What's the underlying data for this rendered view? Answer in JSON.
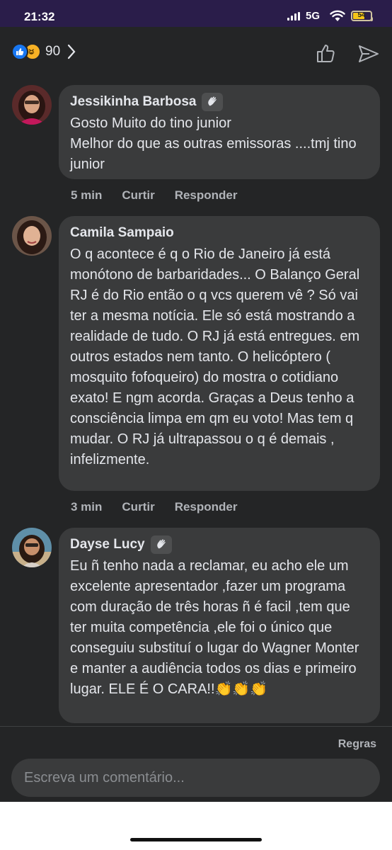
{
  "status_bar": {
    "time": "21:32",
    "network": "5G",
    "battery": "54"
  },
  "header": {
    "reaction_count": "90",
    "reaction_icons": [
      "like-icon",
      "haha-icon"
    ],
    "actions": [
      "like-outline-icon",
      "send-icon"
    ]
  },
  "comments": [
    {
      "author": "Jessikinha Barbosa",
      "badge": "wave-icon",
      "text": "Gosto Muito do tino junior\nMelhor do que as outras emissoras ....tmj tino junior",
      "time": "5 min",
      "like_label": "Curtir",
      "reply_label": "Responder"
    },
    {
      "author": "Camila Sampaio",
      "text": "O q acontece é q o Rio de Janeiro já está monótono de barbaridades... O Balanço Geral RJ é do Rio então o q vcs querem vê ? Só vai ter a mesma notícia. Ele só está mostrando a realidade de tudo. O RJ já está entregues. em outros estados nem tanto. O helicóptero ( mosquito fofoqueiro) do mostra o cotidiano exato! E ngm acorda. Graças a Deus tenho a consciência limpa em qm eu voto! Mas tem q mudar. O RJ já ultrapassou o q é demais , infelizmente.",
      "time": "3 min",
      "like_label": "Curtir",
      "reply_label": "Responder"
    },
    {
      "author": "Dayse Lucy",
      "badge": "wave-icon",
      "text": "Eu ñ tenho nada a reclamar, eu acho ele um excelente apresentador ,fazer um programa com duração  de três horas ñ é facil ,tem  que ter muita competência ,ele foi o único que conseguiu substituí o lugar do Wagner Monter e manter a audiência todos os dias e primeiro lugar. ELE É O CARA!!👏👏👏"
    }
  ],
  "footer": {
    "rules_label": "Regras",
    "comment_placeholder": "Escreva um comentário..."
  },
  "colors": {
    "background": "#242526",
    "bubble": "#3a3b3c",
    "text": "#e4e6eb",
    "muted": "#b0b3b8",
    "status_bar": "#2a1d4a",
    "like_blue": "#1877f2",
    "haha_yellow": "#f7b125"
  }
}
